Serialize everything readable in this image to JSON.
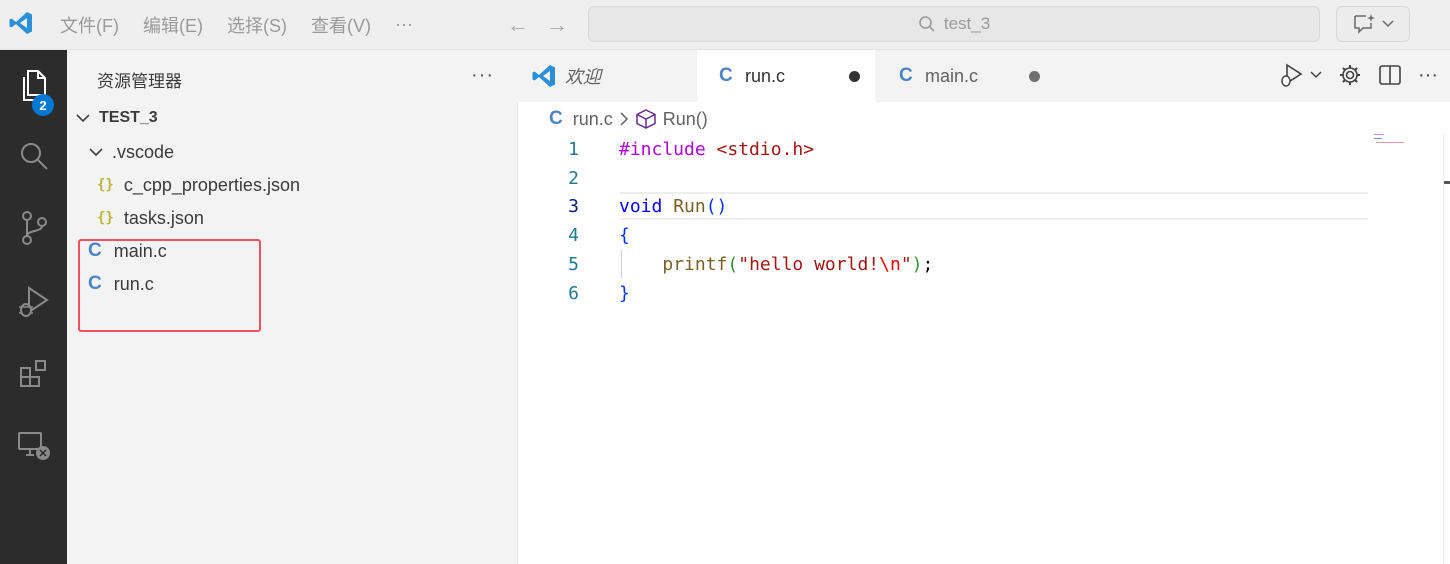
{
  "titlebar": {
    "menu": [
      "文件(F)",
      "编辑(E)",
      "选择(S)",
      "查看(V)",
      "···"
    ],
    "search_text": "test_3"
  },
  "activity": {
    "explorer_badge": "2"
  },
  "sidebar": {
    "title": "资源管理器",
    "more": "···",
    "root": "TEST_3",
    "folder": ".vscode",
    "files": [
      {
        "name": "c_cpp_properties.json",
        "icon": "json-icon"
      },
      {
        "name": "tasks.json",
        "icon": "json-icon"
      },
      {
        "name": "main.c",
        "icon": "c-file-icon"
      },
      {
        "name": "run.c",
        "icon": "c-file-icon"
      }
    ]
  },
  "tabs": [
    {
      "label": "欢迎",
      "italic": true
    },
    {
      "label": "run.c",
      "active": true,
      "modified": true
    },
    {
      "label": "main.c",
      "active": false,
      "modified": true
    }
  ],
  "breadcrumb": {
    "file": "run.c",
    "symbol": "Run()"
  },
  "editor": {
    "line_numbers": [
      "1",
      "2",
      "3",
      "4",
      "5",
      "6"
    ],
    "current_line": "3",
    "line1": {
      "directive": "#include",
      "header": "<stdio.h>"
    },
    "line3": {
      "type": "void",
      "fn": "Run",
      "parens": "()"
    },
    "line4": {
      "brace": "{"
    },
    "line5": {
      "fn": "printf",
      "open": "(",
      "str": "\"hello world!",
      "esc": "\\n",
      "str_end": "\"",
      "close": ")",
      "semi": ";"
    },
    "line6": {
      "brace": "}"
    }
  },
  "colors": {
    "accent": "#0078d4",
    "highlight_box": "#f0505f",
    "c_icon": "#4d84c4",
    "json_icon": "#b7b73b"
  }
}
